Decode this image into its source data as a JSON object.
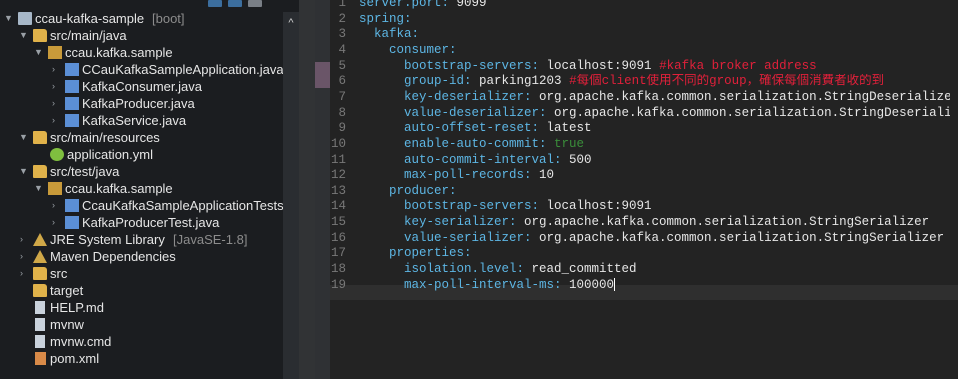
{
  "explorer": {
    "project": {
      "name": "ccau-kafka-sample",
      "decoration": "[boot]"
    },
    "main_java": "src/main/java",
    "main_pkg": "ccau.kafka.sample",
    "main_files": [
      "CCauKafkaSampleApplication.java",
      "KafkaConsumer.java",
      "KafkaProducer.java",
      "KafkaService.java"
    ],
    "main_resources": "src/main/resources",
    "resource_file": "application.yml",
    "test_java": "src/test/java",
    "test_pkg": "ccau.kafka.sample",
    "test_files": [
      "CcauKafkaSampleApplicationTests.java",
      "KafkaProducerTest.java"
    ],
    "jre": {
      "name": "JRE System Library",
      "decoration": "[JavaSE-1.8]"
    },
    "maven": "Maven Dependencies",
    "others": [
      "src",
      "target",
      "HELP.md",
      "mvnw",
      "mvnw.cmd",
      "pom.xml"
    ]
  },
  "editor": {
    "file": "application.yml",
    "lines": [
      {
        "n": "1",
        "key": "server.port:",
        "val": " 9099",
        "comment": ""
      },
      {
        "n": "2",
        "key": "spring:",
        "val": "",
        "comment": ""
      },
      {
        "n": "3",
        "key": "  kafka:",
        "val": "",
        "comment": ""
      },
      {
        "n": "4",
        "key": "    consumer:",
        "val": "",
        "comment": ""
      },
      {
        "n": "5",
        "key": "      bootstrap-servers:",
        "val": " localhost:9091 ",
        "comment": "#kafka broker address"
      },
      {
        "n": "6",
        "key": "      group-id:",
        "val": " parking1203 ",
        "comment": "#每個client使用不同的group，確保每個消費者收的到"
      },
      {
        "n": "7",
        "key": "      key-deserializer:",
        "val": " org.apache.kafka.common.serialization.StringDeserializer",
        "comment": ""
      },
      {
        "n": "8",
        "key": "      value-deserializer:",
        "val": " org.apache.kafka.common.serialization.StringDeserializer",
        "comment": ""
      },
      {
        "n": "9",
        "key": "      auto-offset-reset:",
        "val": " latest",
        "comment": ""
      },
      {
        "n": "10",
        "key": "      enable-auto-commit:",
        "val": " true",
        "comment": "",
        "green": true
      },
      {
        "n": "11",
        "key": "      auto-commit-interval:",
        "val": " 500",
        "comment": ""
      },
      {
        "n": "12",
        "key": "      max-poll-records:",
        "val": " 10",
        "comment": ""
      },
      {
        "n": "13",
        "key": "    producer:",
        "val": "",
        "comment": ""
      },
      {
        "n": "14",
        "key": "      bootstrap-servers:",
        "val": " localhost:9091",
        "comment": ""
      },
      {
        "n": "15",
        "key": "      key-serializer:",
        "val": " org.apache.kafka.common.serialization.StringSerializer",
        "comment": ""
      },
      {
        "n": "16",
        "key": "      value-serializer:",
        "val": " org.apache.kafka.common.serialization.StringSerializer",
        "comment": ""
      },
      {
        "n": "17",
        "key": "    properties:",
        "val": "",
        "comment": ""
      },
      {
        "n": "18",
        "key": "      isolation.level:",
        "val": " read_committed",
        "comment": ""
      },
      {
        "n": "19",
        "key": "      max-poll-interval-ms:",
        "val": " 100000",
        "comment": "",
        "cursor": true
      }
    ]
  },
  "colors": {
    "key": "#5db6e4",
    "value": "#e6e6e6",
    "comment": "#e0203a",
    "boolean": "#3a8d3a"
  }
}
